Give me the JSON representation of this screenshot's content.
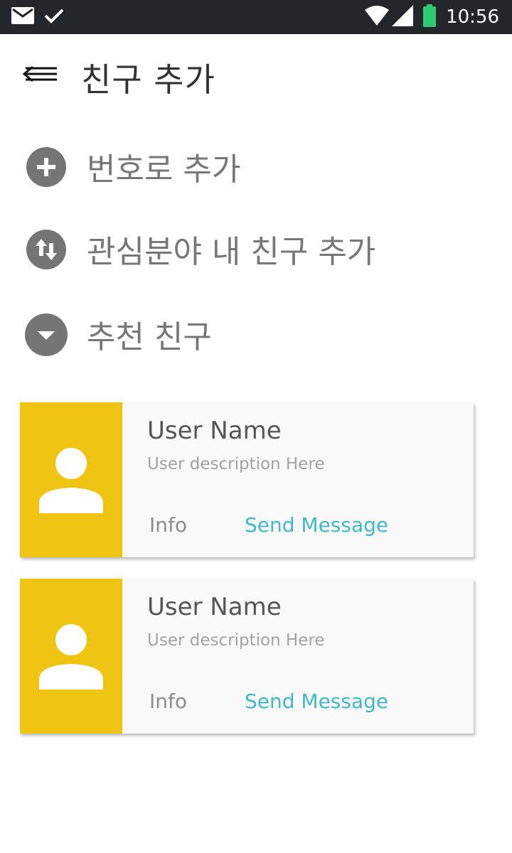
{
  "status_bar": {
    "time": "10:56",
    "icons": [
      "mail-icon",
      "check-icon",
      "wifi-icon",
      "signal-icon",
      "battery-icon"
    ]
  },
  "header": {
    "menu_icon": "menu-back-icon",
    "title": "친구 추가"
  },
  "options": [
    {
      "icon": "plus-circle-icon",
      "label": "번호로 추가"
    },
    {
      "icon": "swap-circle-icon",
      "label": "관심분야 내 친구 추가"
    },
    {
      "icon": "chevron-down-circle-icon",
      "label": "추천 친구"
    }
  ],
  "cards": [
    {
      "name": "User Name",
      "description": "User description Here",
      "info_label": "Info",
      "send_label": "Send Message"
    },
    {
      "name": "User Name",
      "description": "User description Here",
      "info_label": "Info",
      "send_label": "Send Message"
    }
  ],
  "colors": {
    "status_bar": "#23272b",
    "avatar_bg": "#f0c412",
    "accent": "#3fb8c9",
    "icon_gray": "#757575",
    "battery": "#2ecc71"
  }
}
